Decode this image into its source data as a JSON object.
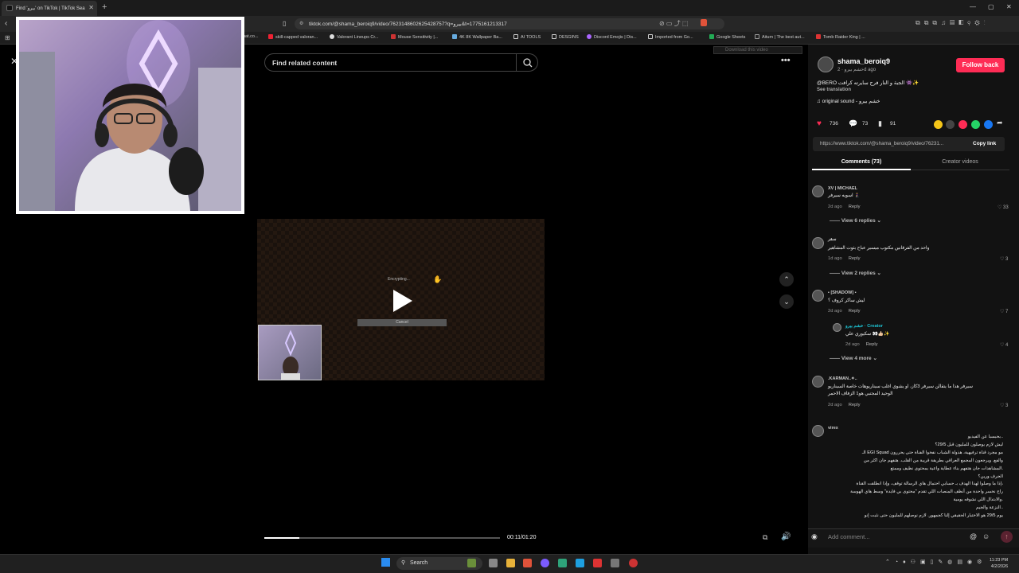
{
  "browser": {
    "tab_title": "Find 'بيرو' on TikTok | TikTok Sea",
    "url": "tiktok.com/@shama_beroiq9/video/7623148602625428757?q=بيرو&t=1775161213317",
    "bookmarks": [
      "hat.co...",
      "skill-capped valoran...",
      "Valorant Lineups Cr...",
      "Mouse Sensitivity |...",
      "4K 8K Wallpaper Ba...",
      "AI TOOLS",
      "DESGINS",
      "Discord Emojis | Dis...",
      "Imported from Go...",
      "Google Sheets",
      "Aitum | The best aut...",
      "Tomb Raider King | ..."
    ],
    "download_hint": "Download this video"
  },
  "video": {
    "search_placeholder": "Find related content",
    "energy_text": "Encrypting...",
    "cancel_label": "Cancel",
    "time": "00:11/01:20",
    "progress": 0.15
  },
  "post": {
    "username": "shama_beroiq9",
    "sub": "خشم بيرو · 2d ago",
    "follow_label": "Follow back",
    "caption": "@BERO الجبة و النار فرح سايرته كرافت 👾✨",
    "see_translation": "See translation",
    "sound": "♫ original sound - خشم بيرو",
    "likes": "736",
    "comments_count": "73",
    "saves": "91",
    "link": "https://www.tiktok.com/@shama_beroiq9/video/76231...",
    "copy_link": "Copy link",
    "tab_comments": "Comments (73)",
    "tab_creator": "Creator videos",
    "comment_placeholder": "Add comment..."
  },
  "comments": [
    {
      "name": "XV | MICHAEL",
      "text": "اسويه سيرفر 🧎‍♀️",
      "age": "2d ago",
      "reply": "Reply",
      "likes": "33",
      "replies": "View 6 replies"
    },
    {
      "name": "سقر",
      "text": "واحد من الفرقانين مكتوب ميسير عباح بثوت المشاهير",
      "age": "1d ago",
      "reply": "Reply",
      "likes": "3",
      "replies": "View 2 replies"
    },
    {
      "name": "▪ [SHADOW] ▪",
      "text": "ليش ساكر كروف ؟",
      "age": "2d ago",
      "reply": "Reply",
      "likes": "7"
    },
    {
      "name": "خشم بيرو · Creator",
      "text": "سكيوري علي 👀👍🏻✨",
      "age": "2d ago",
      "reply": "Reply",
      "likes": "4",
      "replies": "View 4 more"
    },
    {
      "name": ".KARMAN..✦..",
      "text": "سيرفر هذا ما يتقالن سيرفر 3كاز، او يشوي اغلب سيناريوهات خاصة السيناريو",
      "text2": "الوحيد المجتبي هو1 الزفاف الاحمر",
      "age": "2d ago",
      "reply": "Reply",
      "likes": "3"
    },
    {
      "name": "virex",
      "text": "بحبسبا عن الفيديو..\nليش لازم يوصلون للمليون قبل 29/5؟\nالـ EGI Squad مو مجرد قناة ترفيهية، هذولة الشباب نفخوا الفناة حتى يحررون\nوالفع. ويرجعون المجمع العراقي بطريقة قريبة من القلب. هتفهم جان اكثر من\nالمشاهدات جان هتفهم بناء عطاية واعية بمحتوى نظيف وممتع.\nالحرف ورين؟\nإذا ما وصلوا لهذا الهدف بـ حسابي احتمال هاي الرسالة توقف، وإذا انطلقت القناة،\nراح نخسر واحدة من أنظف المنصات اللي تقدم \"محتوى بي فايدة\" وسط هاي الهوسة\nوالابتذال اللي نشوفه يومية.\nالنزعة والجيم..\nيوم 29/5 هو الاختبار الحقيقي إلنا كجمهور. لازم نوصلهم للمليون حتى نثبت إنو"
    }
  ],
  "taskbar": {
    "search": "Search",
    "time": "11:23 PM",
    "date": "4/2/2026"
  }
}
